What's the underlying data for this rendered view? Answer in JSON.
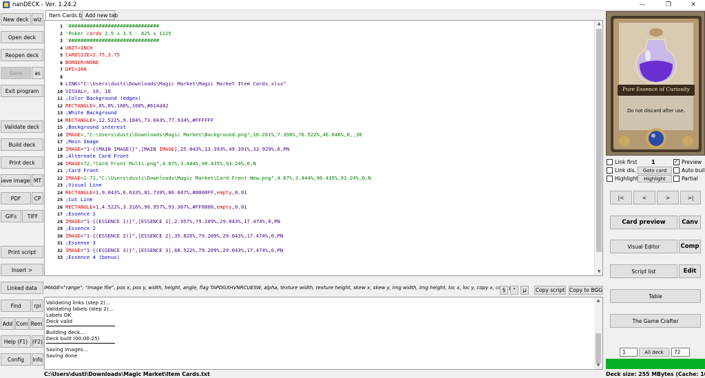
{
  "window": {
    "title": "nanDECK - Ver. 1.24.2",
    "minimize": "—",
    "maximize": "❐",
    "close": "✕"
  },
  "left_buttons": {
    "new_deck": "New deck",
    "wiz": "wiz",
    "open_deck": "Open deck",
    "reopen_deck": "Reopen deck",
    "save": "Save",
    "save_as": "as",
    "exit_program": "Exit program",
    "validate_deck": "Validate deck",
    "build_deck": "Build deck",
    "print_deck": "Print deck",
    "save_images": "Save images",
    "mt": "MT",
    "pdf": "PDF",
    "cp": "CP",
    "gifs": "GIFs",
    "tiff": "TIFF",
    "print_script": "Print script",
    "insert": "Insert >",
    "linked_data": "Linked data",
    "find": "Find",
    "rpl": "rpl",
    "add": "Add",
    "com": "Com",
    "rem": "Rem",
    "help": "Help (F1)",
    "f2": "(F2)",
    "config": "Config",
    "info": "Info"
  },
  "tabs": [
    "Item Cards.txt",
    "Add new tab"
  ],
  "code_lines": [
    {
      "n": "1",
      "parts": [
        {
          "t": "'##############################",
          "c": "c-green"
        }
      ]
    },
    {
      "n": "2",
      "parts": [
        {
          "t": "'Poker ",
          "c": "c-green"
        },
        {
          "t": "cards",
          "c": "c-red"
        },
        {
          "t": " 2.5 x 3.5 - 825 x 1125",
          "c": "c-green"
        }
      ]
    },
    {
      "n": "3",
      "parts": [
        {
          "t": "'##############################",
          "c": "c-green"
        }
      ]
    },
    {
      "n": "4",
      "parts": [
        {
          "t": "UNIT=INCH",
          "c": "c-red"
        }
      ]
    },
    {
      "n": "5",
      "parts": [
        {
          "t": "CARDSIZE=2.75,3.75",
          "c": "c-red"
        }
      ]
    },
    {
      "n": "6",
      "parts": [
        {
          "t": "BORDER=NONE",
          "c": "c-red"
        }
      ]
    },
    {
      "n": "7",
      "parts": [
        {
          "t": "DPI=300",
          "c": "c-red"
        }
      ]
    },
    {
      "n": "8",
      "parts": []
    },
    {
      "n": "9",
      "parts": [
        {
          "t": "LINK=\"C:\\Users\\dusti\\Downloads\\Magic Market\\Magic Market Item Cards.xlsx\"",
          "c": "c-purple"
        }
      ]
    },
    {
      "n": "10",
      "parts": [
        {
          "t": "VISUAL=, 10, 10",
          "c": "c-purple"
        }
      ]
    },
    {
      "n": "11",
      "parts": [
        {
          "t": ";Color Background (edges)",
          "c": "c-blue"
        }
      ]
    },
    {
      "n": "12",
      "parts": [
        {
          "t": "RECTANGLE",
          "c": "c-red"
        },
        {
          "t": "=,0%,0%,100%,100%,#614d42",
          "c": "c-purple"
        }
      ]
    },
    {
      "n": "13",
      "parts": [
        {
          "t": ";White Background",
          "c": "c-blue"
        }
      ]
    },
    {
      "n": "14",
      "parts": [
        {
          "t": "RECTANGLE",
          "c": "c-red"
        },
        {
          "t": "=,12.522%,9.184%,73.043%,77.934%,#FFFFFF",
          "c": "c-purple"
        }
      ]
    },
    {
      "n": "15",
      "parts": [
        {
          "t": ";Background interest",
          "c": "c-blue"
        }
      ]
    },
    {
      "n": "16",
      "parts": [
        {
          "t": "IMAGE",
          "c": "c-red"
        },
        {
          "t": "=,\"C:\\Users\\dusti\\Downloads\\Magic Market\\Background.png\",10.261%,7.398%,76.522%,46.046%,0,,30",
          "c": "c-green"
        }
      ]
    },
    {
      "n": "17",
      "parts": [
        {
          "t": ";Main Image",
          "c": "c-blue"
        }
      ]
    },
    {
      "n": "18",
      "parts": [
        {
          "t": "IMAGE",
          "c": "c-red"
        },
        {
          "t": "=\"1-{(MAIN IMAGE)}\",[MAIN ",
          "c": "c-purple"
        },
        {
          "t": "IMAGE",
          "c": "c-red"
        },
        {
          "t": "],25.043%,13.393%,49.391%,33.929%,0,PN",
          "c": "c-purple"
        }
      ]
    },
    {
      "n": "19",
      "parts": [
        {
          "t": ";Alternate Card Front",
          "c": "c-blue"
        }
      ]
    },
    {
      "n": "20",
      "parts": [
        {
          "t": "IMAGE",
          "c": "c-red"
        },
        {
          "t": "=72,\"Card Front Multi.png\",4.87%,3.444%,90.435%,93.24%,0,N",
          "c": "c-green"
        }
      ]
    },
    {
      "n": "21",
      "parts": [
        {
          "t": ";Card Front",
          "c": "c-blue"
        }
      ]
    },
    {
      "n": "22",
      "parts": [
        {
          "t": "IMAGE",
          "c": "c-red"
        },
        {
          "t": "=1-71,\"C:\\Users\\dusti\\Downloads\\Magic Market\\Card Front New.png\",4.87%,3.444%,90.435%,93.24%,0,N",
          "c": "c-green"
        }
      ]
    },
    {
      "n": "23",
      "parts": [
        {
          "t": ";Visual Line",
          "c": "c-blue"
        }
      ]
    },
    {
      "n": "24",
      "parts": [
        {
          "t": "RECTANGLE",
          "c": "c-red"
        },
        {
          "t": "=1,9.043%,6.633%,81.739%,86.607%,#0000FF,",
          "c": "c-purple"
        },
        {
          "t": "empty",
          "c": "c-red"
        },
        {
          "t": ",0.01",
          "c": "c-purple"
        }
      ]
    },
    {
      "n": "25",
      "parts": [
        {
          "t": ";Cut Line",
          "c": "c-blue"
        }
      ]
    },
    {
      "n": "26",
      "parts": [
        {
          "t": "RECTANGLE",
          "c": "c-red"
        },
        {
          "t": "=1,4.522%,3.316%,90.957%,93.367%,#FF0000,",
          "c": "c-purple"
        },
        {
          "t": "empty",
          "c": "c-red"
        },
        {
          "t": ",0.01",
          "c": "c-purple"
        }
      ]
    },
    {
      "n": "27",
      "parts": [
        {
          "t": ";Essence 1",
          "c": "c-blue"
        }
      ]
    },
    {
      "n": "28",
      "parts": [
        {
          "t": "IMAGE",
          "c": "c-red"
        },
        {
          "t": "=\"1-{(ESSENCE 1)}\",[ESSENCE 1],2.957%,79.209%,29.043%,17.474%,0,PN",
          "c": "c-purple"
        }
      ]
    },
    {
      "n": "29",
      "parts": [
        {
          "t": ";Essence 2",
          "c": "c-blue"
        }
      ]
    },
    {
      "n": "30",
      "parts": [
        {
          "t": "IMAGE",
          "c": "c-red"
        },
        {
          "t": "=\"1-{(ESSENCE 2)}\",[ESSENCE 2],35.826%,79.209%,29.043%,17.474%,0,PN",
          "c": "c-purple"
        }
      ]
    },
    {
      "n": "31",
      "parts": [
        {
          "t": ";Essense 3",
          "c": "c-blue"
        }
      ]
    },
    {
      "n": "32",
      "parts": [
        {
          "t": "IMAGE",
          "c": "c-red"
        },
        {
          "t": "=\"1-{(ESSENCE 3)}\",[ESSENCE 3],68.522%,79.209%,29.043%,17.474%,0,PN",
          "c": "c-purple"
        }
      ]
    },
    {
      "n": "33",
      "parts": [
        {
          "t": ";Essence 4 (bonus)",
          "c": "c-blue"
        }
      ]
    }
  ],
  "syntax_hint": "IMAGE=\"range\", \"image file\", pos x, pos y, width, height, angle, flag TAPDGXHVNRCUESW, alpha, texture width, texture height, skew x, skew y, img width, img height, loc x, loc y, copy x, copy y",
  "hint_buttons": {
    "section": "§",
    "quote": "\"",
    "mu": "µ",
    "copy_script": "Copy script",
    "copy_to_bgg": "Copy to BGG"
  },
  "log_lines": [
    "Validating links (step 2)...",
    "Validating labels (step 2)...",
    "Labels OK",
    "Deck valid",
    "Building deck...",
    "Deck built (00:00:25)",
    "Saving images...",
    "Saving done"
  ],
  "status": {
    "file_path": "C:\\Users\\dusti\\Downloads\\Magic Market\\Item Cards.txt",
    "deck_size": "Deck size: 255 MBytes (Cache: 105 MBytes)"
  },
  "card_preview": {
    "card_title": "Pure Essence of Curiosity",
    "card_text": "Do not discard after use."
  },
  "preview_controls": {
    "link_first": "Link first",
    "link_dis": "Link dis.",
    "highlight_check": "Highlight",
    "card_number": "1",
    "goto_card": "Goto card",
    "highlight_button": "Highlight",
    "preview": "Preview",
    "auto_build": "Auto build",
    "partial": "Partial",
    "first": "|<",
    "prev": "<",
    "next": ">",
    "last": ">|",
    "card_preview": "Card preview",
    "canv": "Canv",
    "visual_editor": "Visual Editor",
    "comp": "Comp",
    "script_list": "Script list",
    "edit": "Edit",
    "table": "Table",
    "game_crafter": "The Game Crafter",
    "range_from": "1",
    "all_deck": "All deck",
    "range_to": "72"
  },
  "colors": {
    "progress": "#06b025",
    "card_frame": "#7a6a52",
    "potion_purple": "#6a2fd0"
  }
}
